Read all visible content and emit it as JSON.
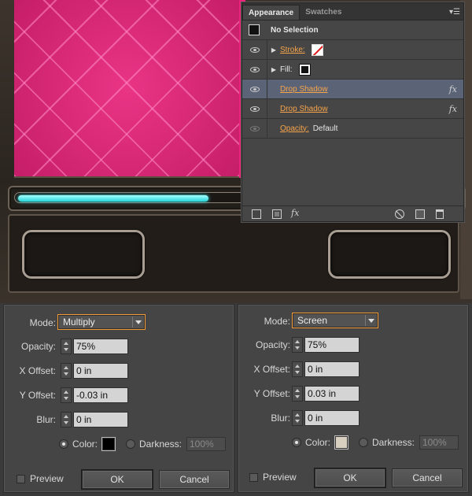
{
  "colors": {
    "accent_orange": "#f39a37",
    "link_orange": "#f7a44a",
    "selected_row": "#5b6477",
    "pink_artwork": "#e8237a",
    "cyan_progress": "#25d3d6",
    "left_shadow_color": "#000000",
    "right_shadow_color": "#d8cfc0"
  },
  "artwork": {
    "progress_fraction": 0.44
  },
  "appearance_panel": {
    "tabs": [
      "Appearance",
      "Swatches"
    ],
    "menu_icon": "panel-menu-icon",
    "header_label": "No Selection",
    "rows": {
      "stroke_label": "Stroke:",
      "fill_label": "Fill:",
      "drop_shadow_1": "Drop Shadow",
      "drop_shadow_2": "Drop Shadow",
      "fx_glyph": "fx",
      "opacity_label": "Opacity:",
      "opacity_value": "Default"
    },
    "footer": {
      "fx_glyph": "fx"
    }
  },
  "dialog_left": {
    "mode_label": "Mode:",
    "mode_value": "Multiply",
    "opacity_label": "Opacity:",
    "opacity_value": "75%",
    "x_offset_label": "X Offset:",
    "x_offset_value": "0 in",
    "y_offset_label": "Y Offset:",
    "y_offset_value": "-0.03 in",
    "blur_label": "Blur:",
    "blur_value": "0 in",
    "color_label": "Color:",
    "darkness_label": "Darkness:",
    "darkness_value": "100%",
    "preview_label": "Preview",
    "ok_label": "OK",
    "cancel_label": "Cancel"
  },
  "dialog_right": {
    "mode_label": "Mode:",
    "mode_value": "Screen",
    "opacity_label": "Opacity:",
    "opacity_value": "75%",
    "x_offset_label": "X Offset:",
    "x_offset_value": "0 in",
    "y_offset_label": "Y Offset:",
    "y_offset_value": "0.03 in",
    "blur_label": "Blur:",
    "blur_value": "0 in",
    "color_label": "Color:",
    "darkness_label": "Darkness:",
    "darkness_value": "100%",
    "preview_label": "Preview",
    "ok_label": "OK",
    "cancel_label": "Cancel"
  }
}
